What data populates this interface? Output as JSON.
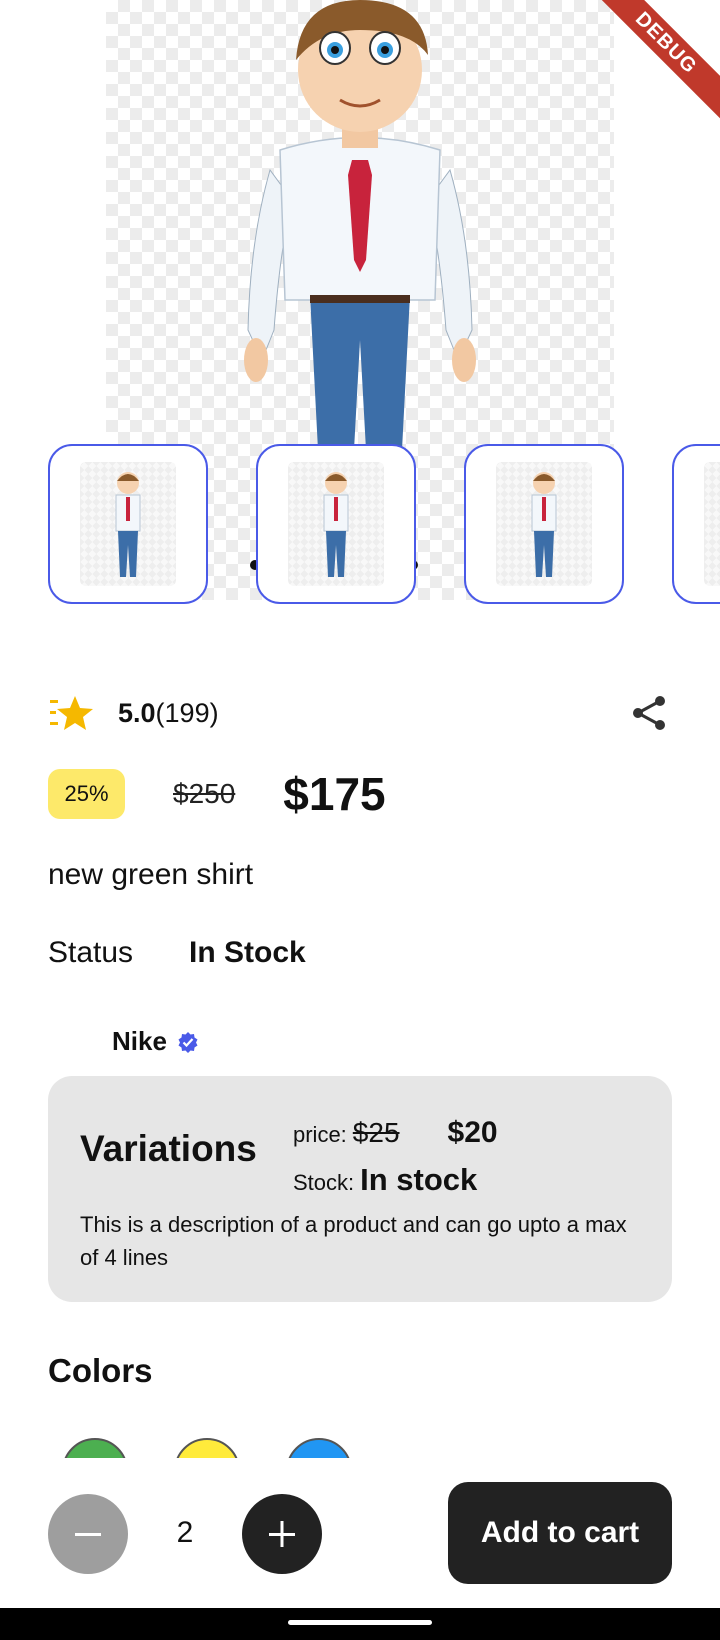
{
  "debug_banner": "DEBUG",
  "rating": {
    "value": "5.0",
    "count": "(199)"
  },
  "price": {
    "discount": "25%",
    "original": "$250",
    "current": "$175"
  },
  "product": {
    "title": "new green shirt"
  },
  "status": {
    "label": "Status",
    "value": "In Stock"
  },
  "brand": {
    "name": "Nike"
  },
  "variations": {
    "title": "Variations",
    "price_label": "price:",
    "original_price": "$25",
    "sale_price": "$20",
    "stock_label": "Stock:",
    "stock_value": "In stock",
    "description": "This is  a description of a product and can go upto a max of 4 lines"
  },
  "colors": {
    "title": "Colors",
    "swatches": [
      "#4caf50",
      "#ffeb3b",
      "#2196f3"
    ]
  },
  "cart": {
    "quantity": "2",
    "add_label": "Add to cart"
  },
  "accent": "#4a5ae8"
}
